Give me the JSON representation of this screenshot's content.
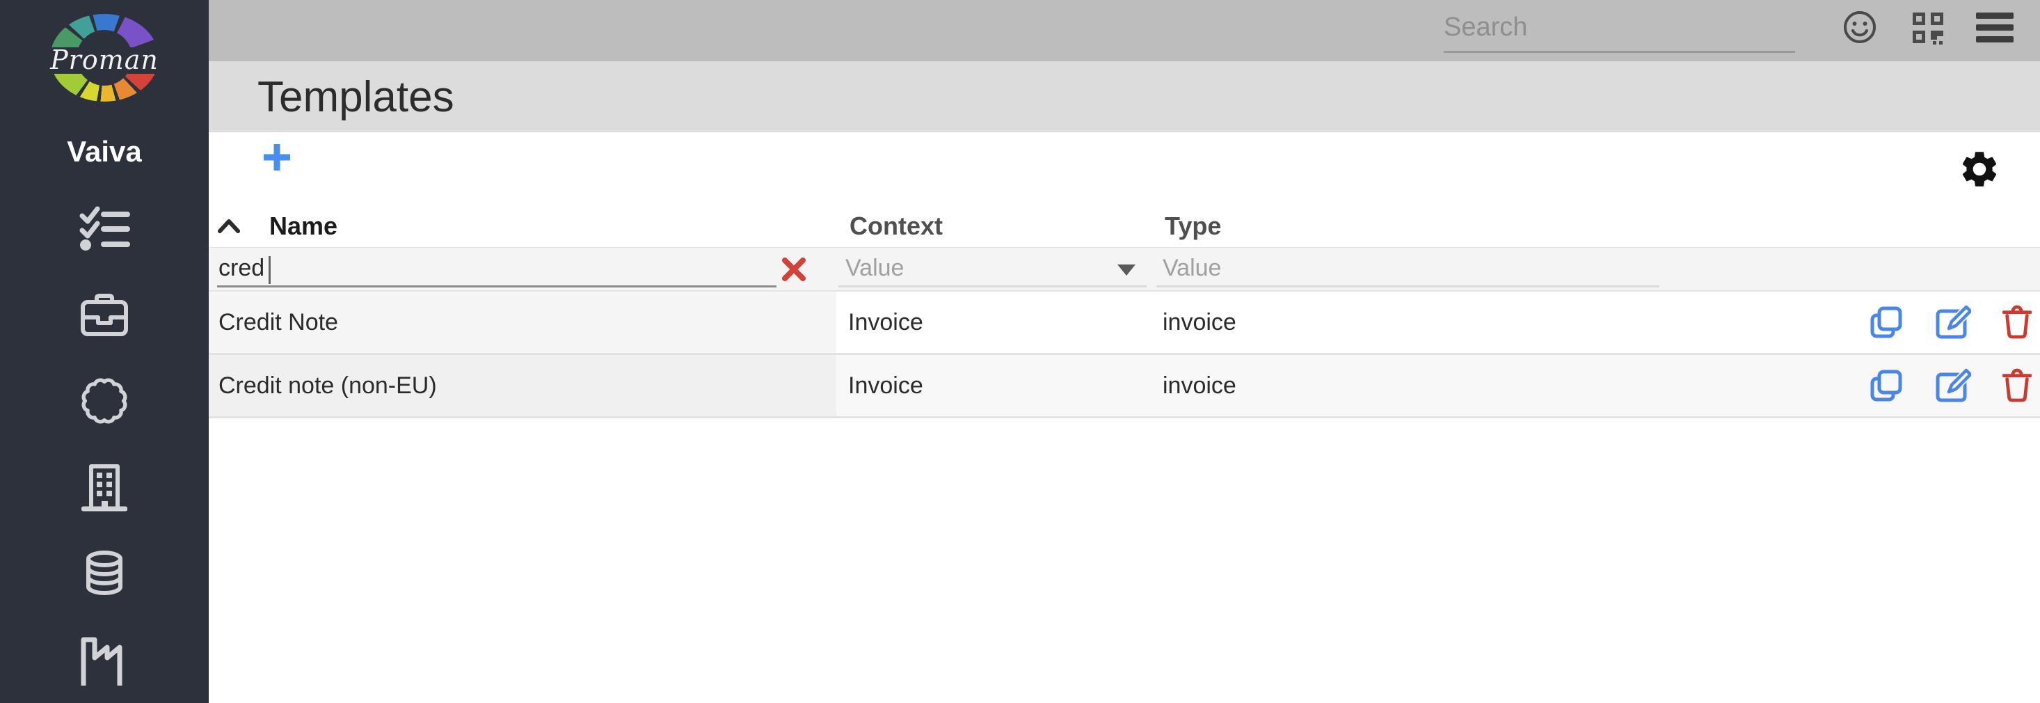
{
  "app": {
    "logo_text": "Proman",
    "workspace_name": "Vaiva"
  },
  "sidebar": {
    "items": [
      {
        "icon": "checklist-icon"
      },
      {
        "icon": "briefcase-icon"
      },
      {
        "icon": "seal-icon"
      },
      {
        "icon": "building-icon"
      },
      {
        "icon": "database-icon"
      },
      {
        "icon": "factory-icon"
      }
    ]
  },
  "topbar": {
    "search": {
      "placeholder": "Search",
      "value": ""
    },
    "icons": [
      "smiley-icon",
      "qr-code-icon",
      "menu-icon"
    ]
  },
  "page": {
    "title": "Templates"
  },
  "toolbar": {
    "add_button": "+",
    "settings_icon": "gear-icon"
  },
  "table": {
    "sort": {
      "column": "Name",
      "direction": "ascending"
    },
    "columns": [
      {
        "label": "Name"
      },
      {
        "label": "Context"
      },
      {
        "label": "Type"
      }
    ],
    "filters": {
      "name": {
        "value": "cred"
      },
      "context": {
        "placeholder": "Value"
      },
      "type": {
        "placeholder": "Value"
      }
    },
    "rows": [
      {
        "name": "Credit Note",
        "context": "Invoice",
        "type": "invoice"
      },
      {
        "name": "Credit note (non-EU)",
        "context": "Invoice",
        "type": "invoice"
      }
    ],
    "row_actions": [
      "copy",
      "edit",
      "delete"
    ]
  },
  "colors": {
    "accent_blue": "#4a86e8",
    "danger_red": "#cb3a30",
    "sidebar_bg": "#2d313c",
    "topbar_bg": "#bdbdbd",
    "pagebar_bg": "#dcdcdc",
    "filter_row_bg": "#f4f4f4"
  }
}
